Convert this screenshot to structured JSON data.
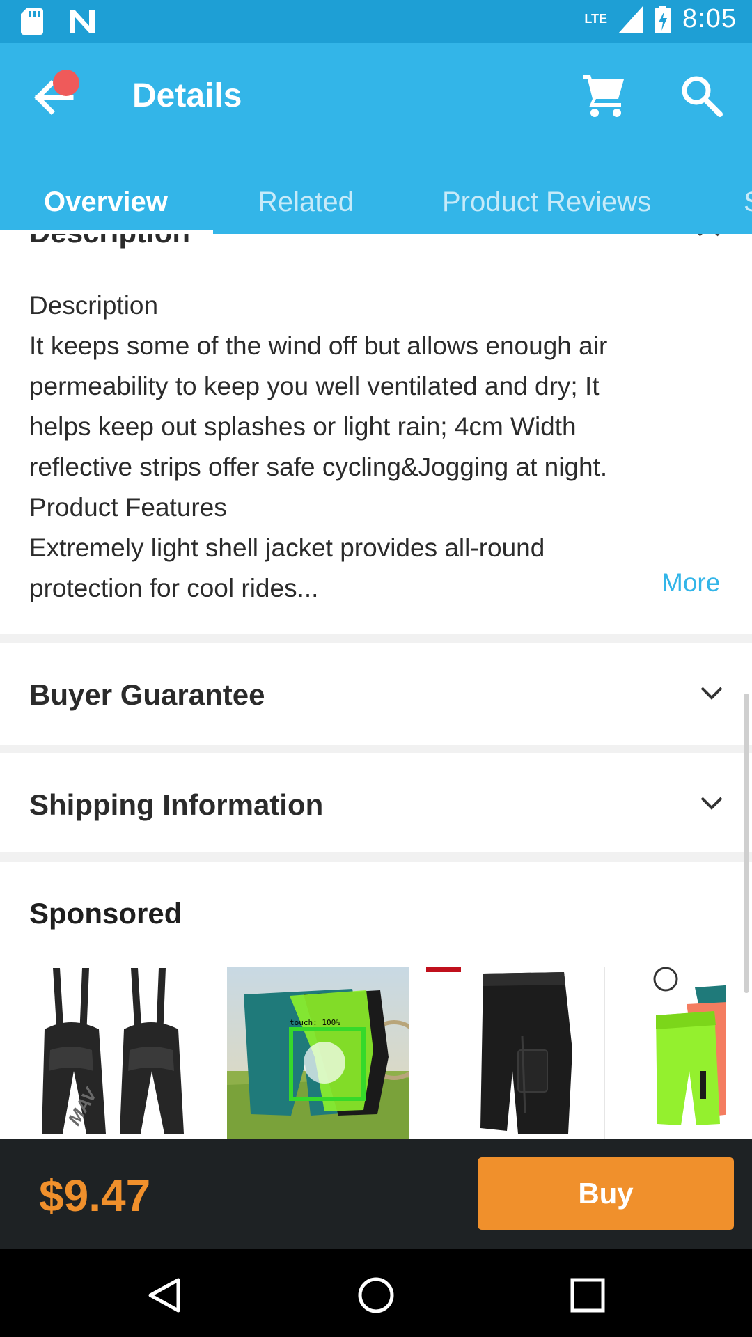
{
  "status_bar": {
    "time": "8:05",
    "network": "LTE",
    "icons": [
      "sd-card-icon",
      "n-logo-icon",
      "signal-icon",
      "battery-charging-icon"
    ]
  },
  "app_bar": {
    "title": "Details",
    "icons": [
      "back-arrow-icon",
      "cart-icon",
      "search-icon"
    ],
    "tabs": [
      {
        "label": "Overview",
        "active": true
      },
      {
        "label": "Related",
        "active": false
      },
      {
        "label": "Product Reviews",
        "active": false
      },
      {
        "label": "S",
        "active": false
      }
    ]
  },
  "description": {
    "header": "Description",
    "lines": [
      "Description",
      "It keeps some of the wind off but allows enough air",
      "permeability to keep you well ventilated and dry; It",
      "helps keep out splashes or light rain; 4cm Width",
      "reflective strips offer safe cycling&Jogging at night.",
      "Product Features",
      "Extremely light shell jacket provides all-round",
      "protection for cool rides..."
    ],
    "more_label": "More"
  },
  "sections": [
    {
      "label": "Buyer Guarantee"
    },
    {
      "label": "Shipping Information"
    }
  ],
  "sponsored": {
    "title": "Sponsored",
    "items": [
      {
        "image": "black-bib-shorts"
      },
      {
        "image": "teal-cycling-shorts"
      },
      {
        "image": "black-cargo-shorts"
      },
      {
        "image": "neon-green-shorts"
      }
    ]
  },
  "buy_bar": {
    "price": "$9.47",
    "buy_label": "Buy"
  },
  "colors": {
    "status_bar": "#1e9fd5",
    "app_bar": "#33b5e8",
    "accent_orange": "#f0902c",
    "link": "#33b5e8",
    "buy_bar_bg": "#1e2224"
  }
}
